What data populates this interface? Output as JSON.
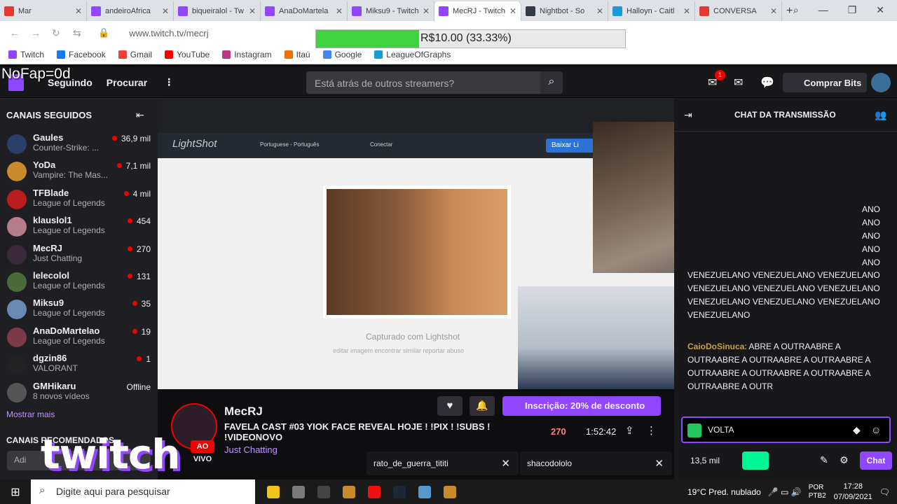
{
  "browser": {
    "tabs": [
      {
        "label": "Mar",
        "color": "#e53935"
      },
      {
        "label": "andeiroAfrica",
        "color": "#9146ff"
      },
      {
        "label": "biqueiralol - Tw",
        "color": "#9146ff"
      },
      {
        "label": "AnaDoMartela",
        "color": "#9146ff"
      },
      {
        "label": "Miksu9 - Twitch",
        "color": "#9146ff"
      },
      {
        "label": "MecRJ - Twitch",
        "color": "#9146ff"
      },
      {
        "label": "Nightbot - So",
        "color": "#333a45"
      },
      {
        "label": "Halloyn - Caitl",
        "color": "#1a9bd7"
      },
      {
        "label": "CONVERSA",
        "color": "#e53935"
      }
    ],
    "new_tab": "+",
    "url": "www.twitch.tv/mecrj",
    "bookmarks": [
      {
        "label": "Twitch",
        "color": "#9146ff"
      },
      {
        "label": "Facebook",
        "color": "#1877f2"
      },
      {
        "label": "Gmail",
        "color": "#ea4335"
      },
      {
        "label": "YouTube",
        "color": "#ff0000"
      },
      {
        "label": "Instagram",
        "color": "#c13584"
      },
      {
        "label": "Itaú",
        "color": "#ec7000"
      },
      {
        "label": "Google",
        "color": "#4285f4"
      },
      {
        "label": "LeagueOfGraphs",
        "color": "#1a9bd7"
      }
    ]
  },
  "donation": {
    "text": "R$10.00 (33.33%)",
    "progress": 0.3333
  },
  "overlay": {
    "nofap": "NoFap=0d",
    "watermark": "twitch"
  },
  "topnav": {
    "following": "Seguindo",
    "browse": "Procurar",
    "search_placeholder": "Está atrás de outros streamers?",
    "notif_count": "1",
    "bits_label": "Comprar Bits"
  },
  "sidebar": {
    "title": "CANAIS SEGUIDOS",
    "channels": [
      {
        "name": "Gaules",
        "game": "Counter-Strike: ...",
        "viewers": "36,9 mil",
        "live": true,
        "avatar": "#2a3f6a"
      },
      {
        "name": "YoDa",
        "game": "Vampire: The Mas...",
        "viewers": "7,1 mil",
        "live": true,
        "avatar": "#c98a2a"
      },
      {
        "name": "TFBlade",
        "game": "League of Legends",
        "viewers": "4 mil",
        "live": true,
        "avatar": "#b91c1c"
      },
      {
        "name": "klauslol1",
        "game": "League of Legends",
        "viewers": "454",
        "live": true,
        "avatar": "#b57d8c"
      },
      {
        "name": "MecRJ",
        "game": "Just Chatting",
        "viewers": "270",
        "live": true,
        "avatar": "#3b2a3a"
      },
      {
        "name": "lelecolol",
        "game": "League of Legends",
        "viewers": "131",
        "live": true,
        "avatar": "#4a6a3a"
      },
      {
        "name": "Miksu9",
        "game": "League of Legends",
        "viewers": "35",
        "live": true,
        "avatar": "#6a8ab5"
      },
      {
        "name": "AnaDoMartelao",
        "game": "League of Legends",
        "viewers": "19",
        "live": true,
        "avatar": "#7a3a4a"
      },
      {
        "name": "dgzin86",
        "game": "VALORANT",
        "viewers": "1",
        "live": true,
        "avatar": "#222"
      },
      {
        "name": "GMHikaru",
        "game": "8 novos vídeos",
        "viewers": "Offline",
        "live": false,
        "avatar": "#555"
      }
    ],
    "show_more": "Mostrar mais",
    "recommended": "CANAIS RECOMENDADOS",
    "search_placeholder": "Adi"
  },
  "stream": {
    "lightshot_logo": "LightShot",
    "lightshot_lang": "Portuguese - Português",
    "lightshot_connect": "Conectar",
    "lightshot_download": "Baixar Li",
    "captured": "Capturado com Lightshot",
    "capture_opts": "editar imagem    encontrar similar    reportar abuso",
    "channel": "MecRJ",
    "title": "FAVELA CAST #03 YIOK FACE REVEAL HOJE ! !PIX ! !SUBS ! !VIDEONOVO",
    "category": "Just Chatting",
    "live": "AO VIVO",
    "subscribe": "Inscrição: 20% de desconto",
    "viewers": "270",
    "uptime": "1:52:42",
    "popups": [
      "rato_de_guerra_tititi",
      "shacodololo"
    ]
  },
  "chat": {
    "title": "CHAT DA TRANSMISSÃO",
    "spam": "VENEZUELANO VENEZUELANO VENEZUELANO VENEZUELANO VENEZUELANO VENEZUELANO VENEZUELANO VENEZUELANO VENEZUELANO VENEZUELANO",
    "spam_right": "ANO ANO ANO ANO ANO",
    "user": "CaioDoSinuca",
    "message": ": ABRE A OUTRAABRE A OUTRAABRE A OUTRAABRE A OUTRAABRE A OUTRAABRE A OUTRAABRE A OUTRAABRE A OUTRAABRE A OUTR",
    "input": "VOLTA",
    "points": "13,5 mil",
    "send": "Chat"
  },
  "taskbar": {
    "search_placeholder": "Digite aqui para pesquisar",
    "weather": "19°C  Pred. nublado",
    "lang": "POR PTB2",
    "time": "17:28",
    "date": "07/09/2021",
    "apps": [
      "#f0c419",
      "#7a7a7a",
      "#444",
      "#c98a2a",
      "#e11",
      "#1b2838",
      "#59c",
      "#c98a2a"
    ]
  }
}
